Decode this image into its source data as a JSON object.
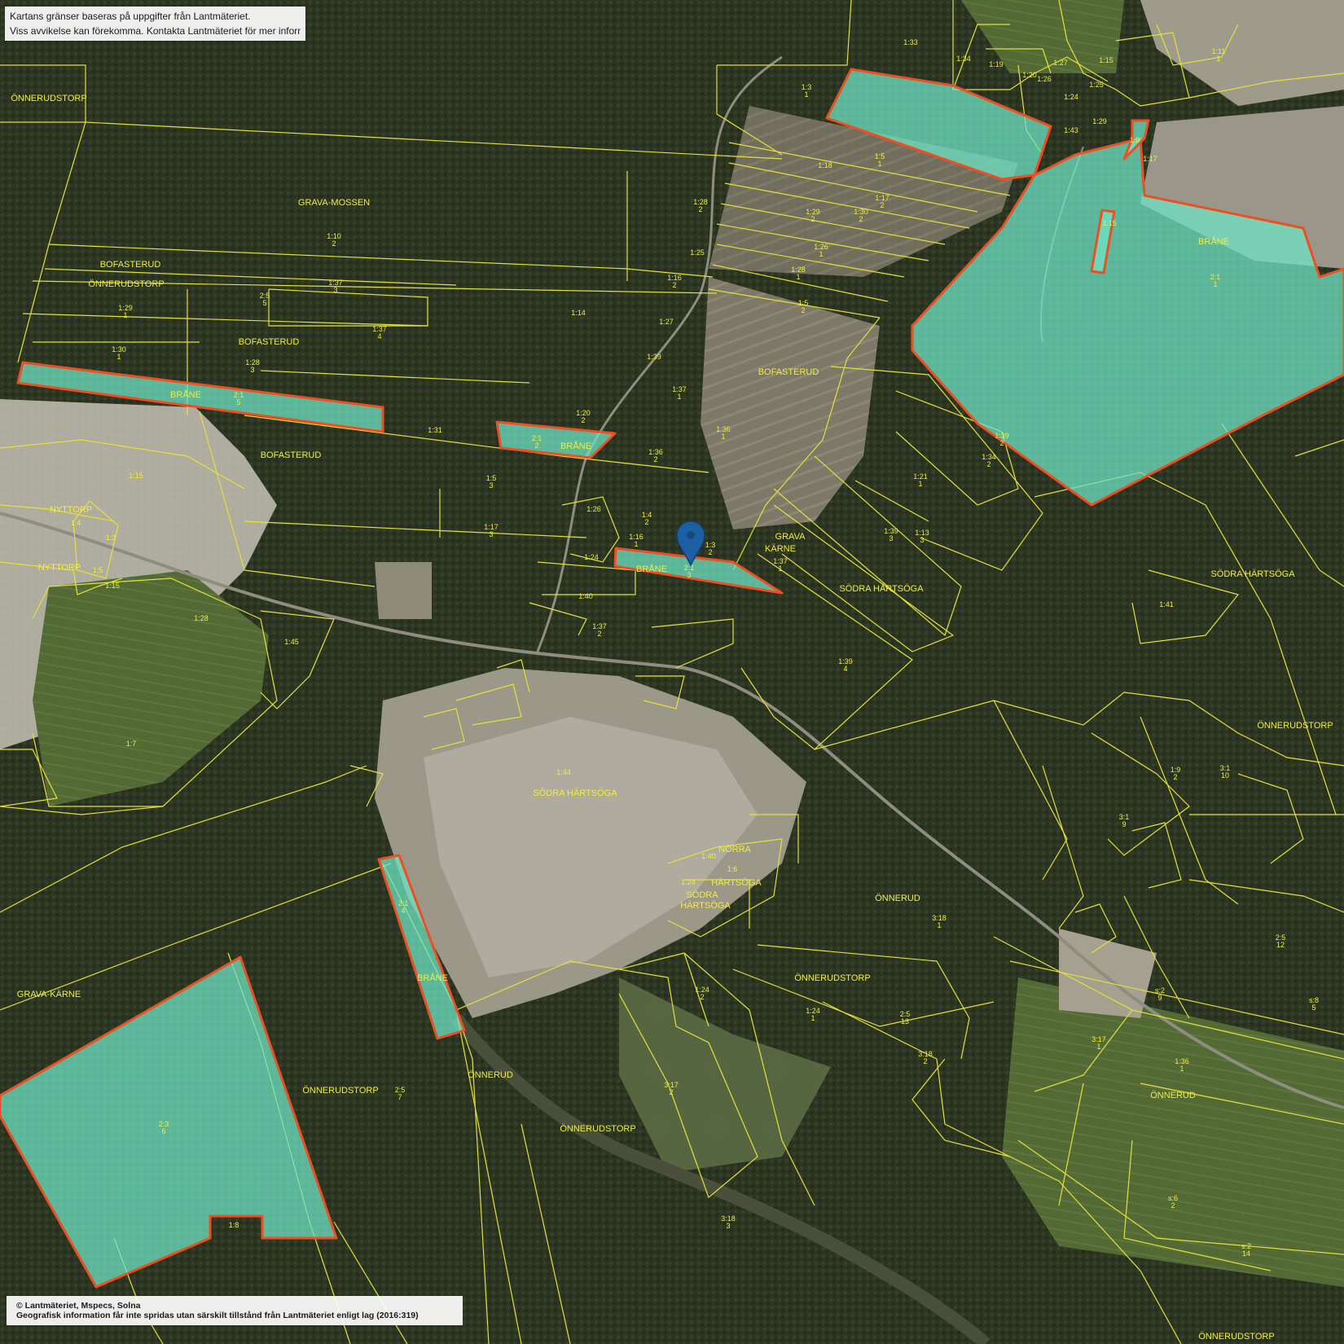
{
  "notices": {
    "top_line1": "Kartans gränser baseras på uppgifter från Lantmäteriet.",
    "top_line2": "Viss avvikelse kan förekomma. Kontakta Lantmäteriet för mer information.",
    "copyright": "© Lantmäteriet, Mspecs, Solna",
    "license": "Geografisk information får inte spridas utan särskilt tillstånd från Lantmäteriet enligt lag (2016:319)"
  },
  "colors": {
    "parcel_border": "#e5e03a",
    "selected_fill": "#6fe3c3",
    "selected_border": "#ee4f22",
    "marker": "#1d5fa3"
  },
  "marker": {
    "icon": "map-pin-icon"
  },
  "place_names": {
    "onnerudstorp_nw": "ÖNNERUDSTORP",
    "grava_mossen": "GRAVA-MOSSEN",
    "bofasterud_1": "BOFASTERUD",
    "onnerudstorp_2": "ÖNNERUDSTORP",
    "bofasterud_2": "BOFASTERUD",
    "brane_1": "BRÅNE",
    "brane_2": "BRÅNE",
    "bofasterud_3": "BOFASTERUD",
    "nyttorp_1": "NYTTORP",
    "nyttorp_2": "NYTTORP",
    "bofasterud_4": "BOFASTERUD",
    "grava_karne_top": "GRAVA",
    "grava_karne_bot": "KÄRNE",
    "brane_3": "BRÅNE",
    "sodra_hartsoga_1": "SÖDRA HÄRTSÖGA",
    "sodra_hartsoga_2": "SÖDRA HÄRTSÖGA",
    "sodra_hartsoga_3": "SÖDRA HÄRTSÖGA",
    "brane_ne": "BRÅNE",
    "onnerudstorp_e": "ÖNNERUDSTORP",
    "norra": "NORRA",
    "hartsoga": "HÄRTSÖGA",
    "sodra_a": "SÖDRA",
    "sodra_b": "HÄRTSÖGA",
    "onnerud_1": "ÖNNERUD",
    "brane_4": "BRÅNE",
    "grava_karne": "GRAVA-KÄRNE",
    "onnerudstorp_3": "ÖNNERUDSTORP",
    "onnerudstorp_4": "ÖNNERUDSTORP",
    "onnerud_2": "ÖNNERUD",
    "onnerudstorp_5": "ÖNNERUDSTORP",
    "onnerud_3": "ÖNNERUD",
    "onnerudstorp_6": "ÖNNERUDSTORP"
  },
  "parcel_labels": [
    [
      "1:33",
      ""
    ],
    [
      "1:34",
      ""
    ],
    [
      "1:19",
      ""
    ],
    [
      "1:20",
      ""
    ],
    [
      "1:26",
      ""
    ],
    [
      "1:27",
      ""
    ],
    [
      "1:25",
      ""
    ],
    [
      "1:3",
      "1"
    ],
    [
      "1:18",
      ""
    ],
    [
      "1:5",
      "1"
    ],
    [
      "1:17",
      "2"
    ],
    [
      "1:28",
      "2"
    ],
    [
      "1:29",
      "2"
    ],
    [
      "1:30",
      "2"
    ],
    [
      "1:26",
      "1"
    ],
    [
      "1:28",
      "1"
    ],
    [
      "1:25",
      ""
    ],
    [
      "1:16",
      "2"
    ],
    [
      "1:27",
      ""
    ],
    [
      "1:14",
      ""
    ],
    [
      "1:5",
      "2"
    ],
    [
      "1:10",
      "2"
    ],
    [
      "1:37",
      "3"
    ],
    [
      "2:5",
      "5"
    ],
    [
      "1:29",
      "1"
    ],
    [
      "1:37",
      "4"
    ],
    [
      "1:28",
      "3"
    ],
    [
      "1:30",
      "1"
    ],
    [
      "2:1",
      "5"
    ],
    [
      "1:39",
      ""
    ],
    [
      "1:37",
      "1"
    ],
    [
      "1:36",
      "1"
    ],
    [
      "1:20",
      "2"
    ],
    [
      "1:31",
      ""
    ],
    [
      "1:36",
      "2"
    ],
    [
      "2:1",
      "2"
    ],
    [
      "1:5",
      "3"
    ],
    [
      "1:17",
      "3"
    ],
    [
      "1:26",
      ""
    ],
    [
      "1:4",
      "2"
    ],
    [
      "1:16",
      "1"
    ],
    [
      "1:3",
      "2"
    ],
    [
      "1:37",
      "1"
    ],
    [
      "1:24",
      ""
    ],
    [
      "2:1",
      "3"
    ],
    [
      "1:40",
      ""
    ],
    [
      "1:37",
      "2"
    ],
    [
      "1:15",
      ""
    ],
    [
      "1:4",
      ""
    ],
    [
      "1:3",
      ""
    ],
    [
      "1:5",
      ""
    ],
    [
      "1:15",
      ""
    ],
    [
      "1:28",
      ""
    ],
    [
      "1:45",
      ""
    ],
    [
      "1:7",
      ""
    ],
    [
      "1:44",
      ""
    ],
    [
      "1:21",
      "1"
    ],
    [
      "1:39",
      "2"
    ],
    [
      "1:34",
      "2"
    ],
    [
      "1:39",
      "3"
    ],
    [
      "1:13",
      "3"
    ],
    [
      "1:39",
      "4"
    ],
    [
      "1:41",
      ""
    ],
    [
      "1:11",
      "1"
    ],
    [
      "1:15",
      ""
    ],
    [
      "1:43",
      ""
    ],
    [
      "1:24",
      ""
    ],
    [
      "1:29",
      ""
    ],
    [
      "1:17",
      ""
    ],
    [
      "1:9",
      ""
    ],
    [
      "1:15",
      ""
    ],
    [
      "2:1",
      "1"
    ],
    [
      "1:40",
      ""
    ],
    [
      "1:6",
      ""
    ],
    [
      "1:24",
      ""
    ],
    [
      "3:18",
      "1"
    ],
    [
      "2:1",
      "4"
    ],
    [
      "1:24",
      "2"
    ],
    [
      "1:24",
      "1"
    ],
    [
      "2:5",
      "13"
    ],
    [
      "3:18",
      "2"
    ],
    [
      "3:17",
      "2"
    ],
    [
      "2:5",
      "7"
    ],
    [
      "2:3",
      "6"
    ],
    [
      "1:8",
      ""
    ],
    [
      "3:18",
      "3"
    ],
    [
      "3:1",
      "9"
    ],
    [
      "3:1",
      "10"
    ],
    [
      "1:9",
      "2"
    ],
    [
      "2:5",
      "12"
    ],
    [
      "3:17",
      "1"
    ],
    [
      "1:36",
      "1"
    ],
    [
      "s:2",
      "9"
    ],
    [
      "s:8",
      "5"
    ],
    [
      "s:2",
      "14"
    ],
    [
      "s:6",
      "2"
    ]
  ]
}
